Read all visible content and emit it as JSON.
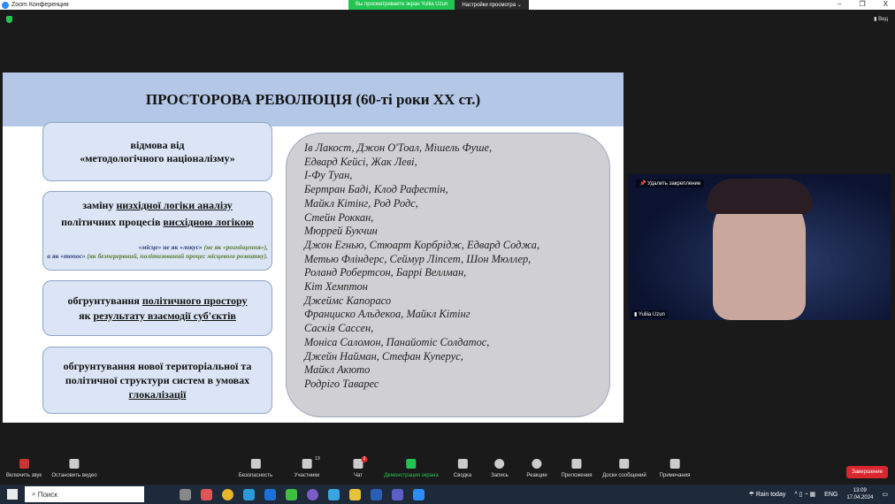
{
  "window": {
    "title": "Zoom Конференция",
    "share_banner": "Вы просматриваете экран Yuliia Uzun",
    "view_settings": "Настройки просмотра ⌄",
    "minimize": "–",
    "restore": "❐",
    "close": "X",
    "view_label": "Вид"
  },
  "slide": {
    "title": "ПРОСТОРОВА РЕВОЛЮЦІЯ (60-ті роки ХХ ст.)",
    "box1": [
      "відмова від",
      "«методологічного націоналізму»"
    ],
    "box2": {
      "a": "заміну ",
      "b": "низхідної логіки аналізу",
      "c": "політичних процесів ",
      "d": "висхідною логікою",
      "note1a": "«місце» не як «локус» ",
      "note1b": "(не як «розміщення»),",
      "note2a": "а як «топос» ",
      "note2b": "(як безперервний, політизований процес місцевого розвитку)."
    },
    "box3": {
      "a": "обгрунтування ",
      "b": "політичного простору",
      "c": "як ",
      "d": "результату взаємодії суб'єктів"
    },
    "box4": {
      "a": "обгрунтування нової територіальної та політичної структури систем в умовах ",
      "b": "глокалізації"
    },
    "authors": [
      "Ів Лакост, Джон О'Тоал, Мішель Фуше,",
      "Едвард Кейсі, Жак Леві,",
      "І-Фу Туан,",
      "Бертран Баді, Клод Рафестін,",
      "Майкл Кітінг, Род Родс,",
      "Стейн Роккан,",
      "Мюррей Букчин",
      "Джон Егнью, Стюарт Корбрідж, Едвард Соджа,",
      "Метью Фліндерс, Сеймур Ліпсет, Шон Мюллер,",
      "Роланд Робертсон, Баррі Веллман,",
      "Кіт Хемптон",
      "Джеймс Капорасо",
      "Франциско Альдекоа, Майкл Кітінг",
      "Саскія Сассен,",
      "Моніса Саломон, Панайотіс Солдатос,",
      "Джейн Найман, Стефан Куперус,",
      "Майкл Акюто",
      "Родріго Таварес"
    ]
  },
  "video": {
    "unpin": "Удалить закрепление",
    "name": "Yuliia Uzun"
  },
  "toolbar": {
    "unmute": "Включить звук",
    "stop_video": "Остановить видео",
    "security": "Безопасность",
    "participants": "Участники",
    "participants_count": "19",
    "chat": "Чат",
    "chat_badge": "2",
    "share": "Демонстрация экрана",
    "summary": "Сводка",
    "record": "Запись",
    "reactions": "Реакции",
    "apps": "Приложения",
    "whiteboards": "Доски сообщений",
    "notes": "Примечания",
    "end": "Завершение"
  },
  "taskbar": {
    "search": "Поиск",
    "weather": "Rain today",
    "lang": "ENG",
    "time": "13:09",
    "date": "17.04.2024"
  }
}
